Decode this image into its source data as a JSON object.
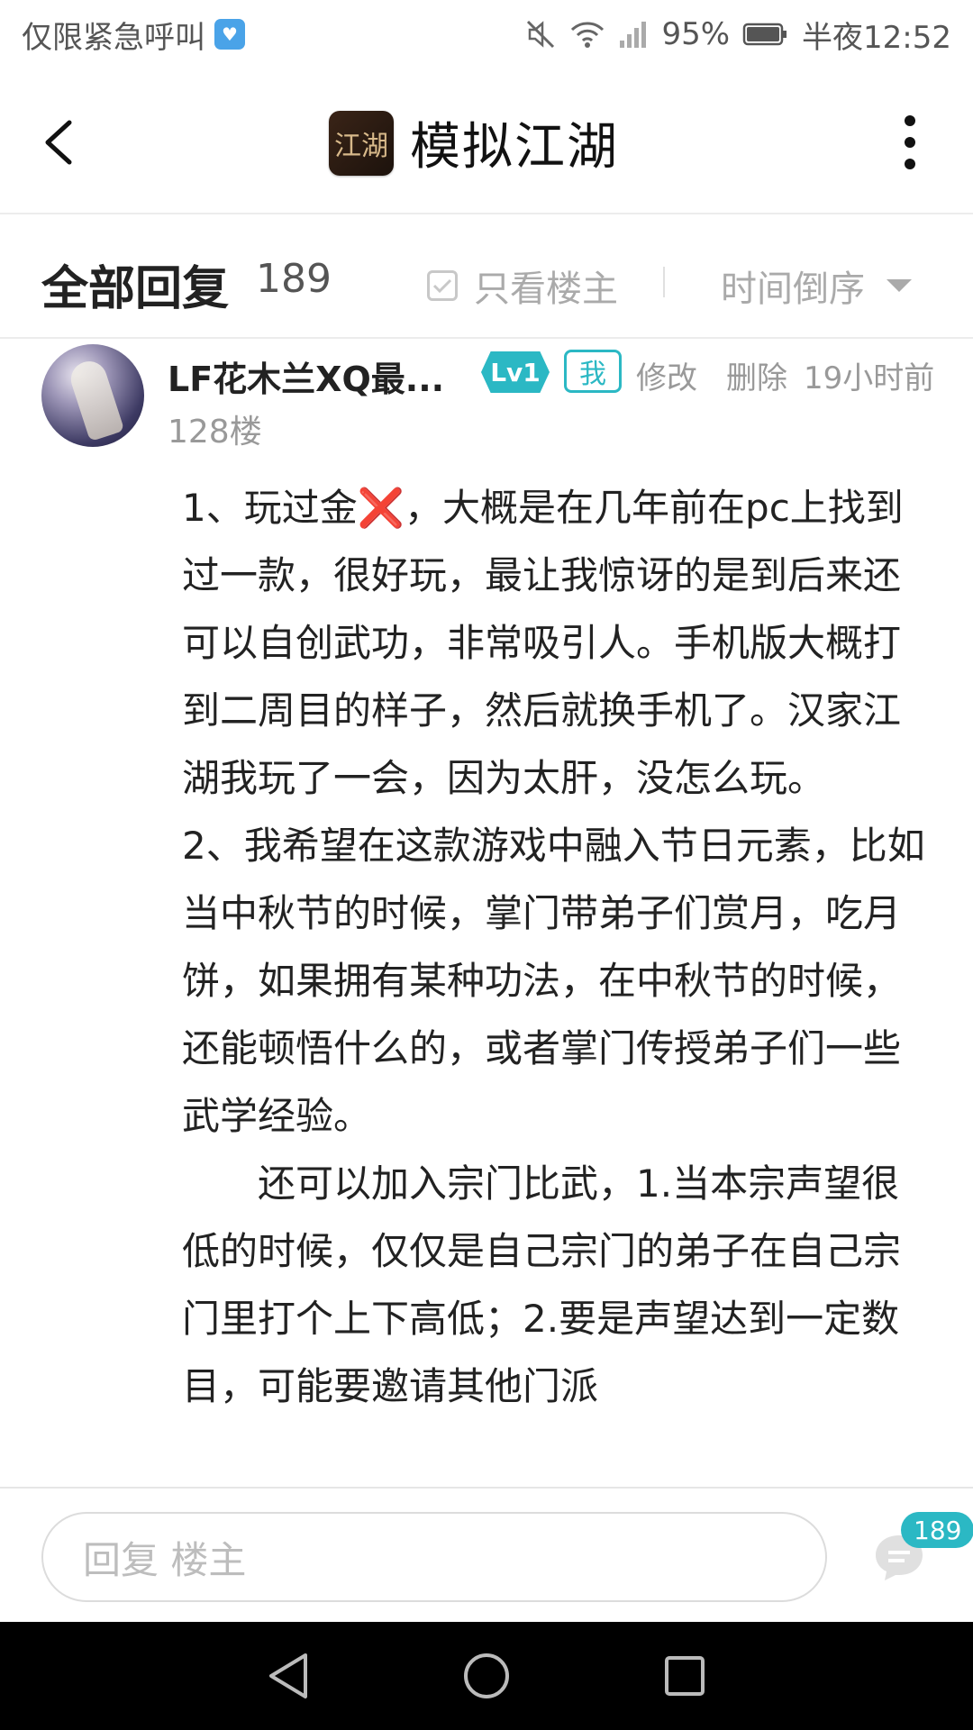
{
  "status_bar": {
    "carrier_text": "仅限紧急呼叫",
    "battery": "95%",
    "time": "半夜12:52"
  },
  "header": {
    "title": "模拟江湖",
    "logo_text": "江湖"
  },
  "filter": {
    "title": "全部回复",
    "count": "189",
    "only_op": "只看楼主",
    "sort": "时间倒序"
  },
  "post": {
    "username": "LF花木兰XQ最...",
    "level": "Lv1",
    "me_badge": "我",
    "edit": "修改",
    "delete": "删除",
    "time": "19小时前",
    "floor": "128楼",
    "para1_before": "1、玩过金",
    "para1_mark": "❌",
    "para1_after": "，大概是在几年前在pc上找到过一款，很好玩，最让我惊讶的是到后来还可以自创武功，非常吸引人。手机版大概打到二周目的样子，然后就换手机了。汉家江湖我玩了一会，因为太肝，没怎么玩。",
    "para2": "2、我希望在这款游戏中融入节日元素，比如当中秋节的时候，掌门带弟子们赏月，吃月饼，如果拥有某种功法，在中秋节的时候，还能顿悟什么的，或者掌门传授弟子们一些武学经验。",
    "para3": "还可以加入宗门比武，1.当本宗声望很低的时候，仅仅是自己宗门的弟子在自己宗门里打个上下高低；2.要是声望达到一定数目，可能要邀请其他门派"
  },
  "bottom": {
    "input_placeholder": "回复  楼主",
    "comment_count": "189"
  },
  "colors": {
    "accent": "#2bb8c4",
    "error_mark": "#e4342c",
    "nav_bg": "#000000"
  },
  "icons": [
    "mute-icon",
    "wifi-icon",
    "signal-icon",
    "battery-icon",
    "back-arrow-icon",
    "more-vertical-icon",
    "checkbox-icon",
    "triangle-down-icon",
    "comment-icon",
    "nav-back-icon",
    "nav-home-icon",
    "nav-recent-icon"
  ]
}
